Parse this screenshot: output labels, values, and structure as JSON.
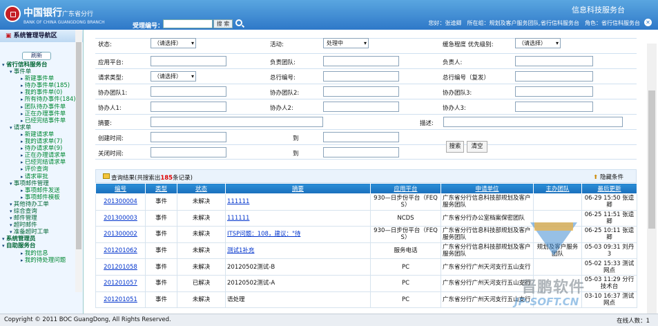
{
  "header": {
    "bank_cn": "中国银行",
    "bank_sub": "广东省分行",
    "bank_en": "BANK OF CHINA GUANGDONG BRANCH",
    "ticket_label": "受理编号：",
    "search_label": "搜 索",
    "app_title": "信息科技服务台",
    "user_info": "您好：张逵卿　所在组：规划及客户服务团队,省行信科服务台　角色：省行信科服务台"
  },
  "sidebar": {
    "title": "系统管理导航区",
    "refresh": "刷新",
    "items": [
      {
        "label": "省行信科服务台",
        "level": 0
      },
      {
        "label": "事件单",
        "level": 1
      },
      {
        "label": "新建事件单",
        "level": 2
      },
      {
        "label": "待办事件单(185)",
        "level": 2
      },
      {
        "label": "我的事件单(0)",
        "level": 2
      },
      {
        "label": "所有待办事件(184)",
        "level": 2
      },
      {
        "label": "团队待办事件单",
        "level": 2
      },
      {
        "label": "正在办理事件单",
        "level": 2
      },
      {
        "label": "已经完结事件单",
        "level": 2
      },
      {
        "label": "请求单",
        "level": 1
      },
      {
        "label": "新建请求单",
        "level": 2
      },
      {
        "label": "我的请求单(7)",
        "level": 2
      },
      {
        "label": "待办请求单(9)",
        "level": 2
      },
      {
        "label": "正在办理请求单",
        "level": 2
      },
      {
        "label": "已经完结请求单",
        "level": 2
      },
      {
        "label": "评价查询",
        "level": 2
      },
      {
        "label": "请求审批",
        "level": 2
      },
      {
        "label": "事项邮件管理",
        "level": 1
      },
      {
        "label": "事项邮件发送",
        "level": 2
      },
      {
        "label": "事项邮件模板",
        "level": 2
      },
      {
        "label": "其他待办工单",
        "level": 1
      },
      {
        "label": "综合查询",
        "level": 1
      },
      {
        "label": "邮件管理",
        "level": 1
      },
      {
        "label": "超时邮件",
        "level": 1
      },
      {
        "label": "准备超时工单",
        "level": 1
      },
      {
        "label": "系统管理员",
        "level": 0
      },
      {
        "label": "自助服务台",
        "level": 0
      },
      {
        "label": "我的信息",
        "level": 2
      },
      {
        "label": "我的待处理问题",
        "level": 2
      }
    ]
  },
  "filters": {
    "status_label": "状态:",
    "status_value": "（请选择）",
    "source_label": "活动:",
    "source_value": "处理中",
    "priority_label": "缓急程度 优先级别:",
    "priority_value": "（请选择）",
    "platform_label": "应用平台:",
    "team_label": "负责团队:",
    "owner_label": "负责人:",
    "type_label": "请求类型:",
    "type_value": "（请选择）",
    "total_no_label": "总行编号:",
    "total_no2_label": "总行编号（复发）",
    "assist_team1": "协办团队1:",
    "assist_team2": "协办团队2:",
    "assist_team3": "协办团队3:",
    "assist_person1": "协办人1:",
    "assist_person2": "协办人2:",
    "assist_person3": "协办人3:",
    "summary_label": "摘要:",
    "desc_label": "描述:",
    "created_label": "创建时间:",
    "closed_label": "关闭时间:",
    "to_label": "到",
    "search_btn": "搜索",
    "clear_btn": "清空"
  },
  "results": {
    "prefix": "查询结果(共搜索出",
    "count": "185",
    "suffix": "条记录)",
    "hide_label": "隐藏条件",
    "columns": [
      "编号",
      "类型",
      "状态",
      "摘要",
      "应用平台",
      "申请单位",
      "主办团队",
      "最后更新"
    ],
    "rows": [
      [
        "201300004",
        "事件",
        "未解决",
        "111111",
        "930—日步份平台（FEQ S）",
        "广东省分行信息科技部规划及客户服务团队",
        "",
        "06-29 15:50 张逵卿"
      ],
      [
        "201300003",
        "事件",
        "未解决",
        "111111",
        "NCDS",
        "广东省分行办公室档案保密团队",
        "",
        "06-25 11:51 张逵卿"
      ],
      [
        "201300002",
        "事件",
        "未解决",
        "ITSP问题：108，建议：\"待",
        "930—日步份平台（FEQ S）",
        "广东省分行信息科技部规划及客户服务团队",
        "",
        "06-25 10:11 张逵卿"
      ],
      [
        "201201062",
        "事件",
        "未解决",
        "测试1补充",
        "服务电话",
        "广东省分行信息科技部规划及客户服务团队",
        "规划及客户服务团队",
        "05-03 09:31 刘丹3"
      ],
      [
        "201201058",
        "事件",
        "未解决",
        "20120502测试-B",
        "PC",
        "广东省分行广州天河支行五山支行",
        "",
        "05-02 15:33 测试网点"
      ],
      [
        "201201057",
        "事件",
        "已解决",
        "20120502测试-A",
        "PC",
        "广东省分行广州天河支行五山支行",
        "",
        "05-03 11:29 分行技术台"
      ],
      [
        "201201051",
        "事件",
        "未解决",
        "语处理",
        "PC",
        "广东省分行广州天河支行五山支行",
        "",
        "03-10 16:37 测试网点"
      ]
    ]
  },
  "footer": {
    "copyright": "Copyright © 2011 BOC GuangDong, All Rights Reserved.",
    "online": "在线人数：1"
  },
  "watermark": {
    "text": "晋鹏软件",
    "sub": "JP-SOFT.CN"
  }
}
